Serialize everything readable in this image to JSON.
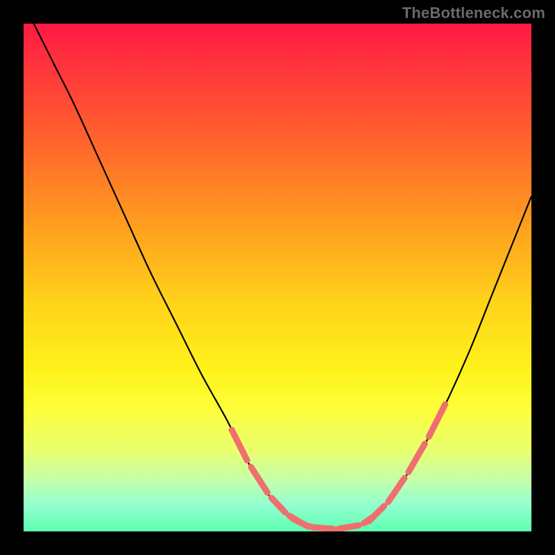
{
  "watermark": "TheBottleneck.com",
  "colors": {
    "page_bg": "#000000",
    "curve": "#000000",
    "dash": "#ef6f6f",
    "gradient_top": "#ff1a44",
    "gradient_bottom": "#18ff8e"
  },
  "chart_data": {
    "type": "line",
    "title": "",
    "xlabel": "",
    "ylabel": "",
    "xlim": [
      0,
      100
    ],
    "ylim": [
      0,
      100
    ],
    "grid": false,
    "series": [
      {
        "name": "left-curve",
        "x": [
          2,
          6,
          10,
          15,
          20,
          25,
          30,
          35,
          40,
          44,
          47,
          50,
          53,
          56
        ],
        "y": [
          100,
          92,
          84,
          73,
          62,
          51,
          41,
          31,
          22,
          14,
          9,
          5,
          2.5,
          1
        ]
      },
      {
        "name": "valley",
        "x": [
          56,
          58,
          60,
          62,
          64,
          66,
          68
        ],
        "y": [
          1,
          0.6,
          0.5,
          0.5,
          0.6,
          1.2,
          2
        ]
      },
      {
        "name": "right-curve",
        "x": [
          68,
          72,
          76,
          80,
          84,
          88,
          92,
          96,
          100
        ],
        "y": [
          2,
          6,
          12,
          19,
          27,
          36,
          46,
          56,
          66
        ]
      }
    ],
    "annotations": [
      {
        "name": "dashed-region-left",
        "x_range": [
          41,
          57
        ],
        "y_range": [
          1,
          20
        ]
      },
      {
        "name": "dashed-region-right",
        "x_range": [
          67,
          83
        ],
        "y_range": [
          1,
          24
        ]
      },
      {
        "name": "dashed-valley-floor",
        "x_range": [
          53,
          69
        ],
        "y_approx": 0.7
      }
    ]
  }
}
